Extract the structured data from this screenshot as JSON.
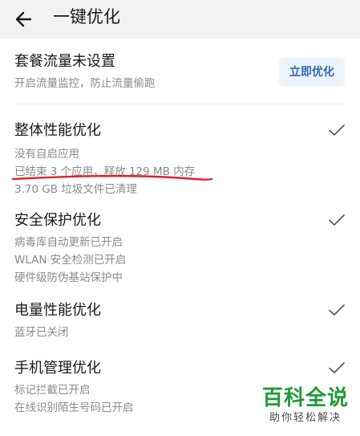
{
  "header": {
    "title": "一键优化",
    "back_icon": "arrow-left-icon"
  },
  "sections": [
    {
      "title": "套餐流量未设置",
      "lines": [
        "开启流量监控，防止流量偷跑"
      ],
      "action_label": "立即优化"
    },
    {
      "title": "整体性能优化",
      "lines": [
        "没有自启应用",
        "已结束 3 个应用，释放 129 MB 内存",
        "3.70 GB 垃圾文件已清理"
      ],
      "status_icon": "checkmark-icon"
    },
    {
      "title": "安全保护优化",
      "lines": [
        "病毒库自动更新已开启",
        "WLAN 安全检测已开启",
        "硬件级防伪基站保护中"
      ],
      "status_icon": "checkmark-icon"
    },
    {
      "title": "电量性能优化",
      "lines": [
        "蓝牙已关闭"
      ],
      "status_icon": "checkmark-icon"
    },
    {
      "title": "手机管理优化",
      "lines": [
        "标记拦截已开启",
        "在线识别陌生号码已开启"
      ],
      "status_icon": "checkmark-icon"
    }
  ],
  "watermark": {
    "brand": "百科全说",
    "slogan": "助你轻松解决"
  },
  "colors": {
    "header_bg": "#f2f2f2",
    "accent": "#2d6db5",
    "button_bg": "#eef3f8",
    "secondary_text": "#8a8a8a",
    "annotation": "#e0202a",
    "watermark_green": "#1f9a3a"
  }
}
